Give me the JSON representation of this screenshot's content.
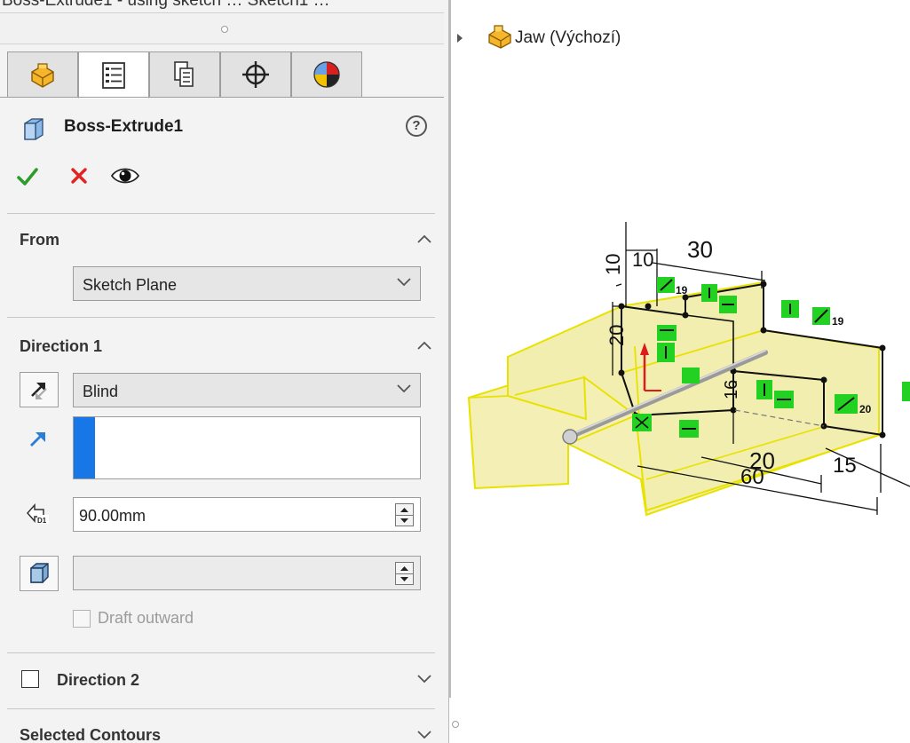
{
  "colors": {
    "accept": "#2d9c2d",
    "cancel": "#e32222",
    "selection_bar": "#1877e6",
    "model_fill": "#f4f0b5",
    "model_edge": "#e8e200",
    "relation_badge": "#22d122"
  },
  "top_strip": {
    "partial_text": "Boss-Extrude1 - using sketch … Sketch1 …"
  },
  "tabs": [
    {
      "icon": "featuremanager-icon"
    },
    {
      "icon": "propertymanager-icon",
      "active": true
    },
    {
      "icon": "configurationmanager-icon"
    },
    {
      "icon": "dimxpertmanager-icon"
    },
    {
      "icon": "displaymanager-icon"
    }
  ],
  "feature": {
    "title": "Boss-Extrude1",
    "help": "?"
  },
  "from_section": {
    "title": "From",
    "selected": "Sketch Plane"
  },
  "direction1": {
    "title": "Direction 1",
    "end_condition": "Blind",
    "depth": "90.00mm",
    "draft_angle": "",
    "draft_outward_label": "Draft outward",
    "draft_outward_checked": false
  },
  "direction2": {
    "title": "Direction 2",
    "checked": false
  },
  "selected_contours": {
    "title": "Selected Contours"
  },
  "tree": {
    "part_name": "Jaw  (Výchozí)"
  },
  "model": {
    "dimensions": [
      "10",
      "30",
      "10",
      "20",
      "20",
      "60",
      "15",
      "16"
    ],
    "angle_dims": [
      "19",
      "19",
      "20"
    ]
  }
}
